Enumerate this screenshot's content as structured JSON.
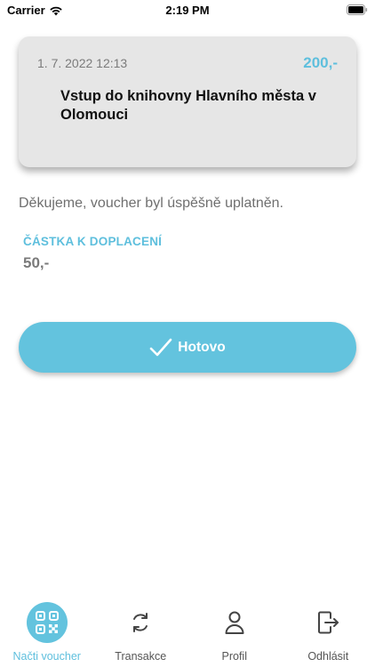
{
  "status_bar": {
    "carrier": "Carrier",
    "time": "2:19 PM"
  },
  "voucher": {
    "date": "1. 7. 2022 12:13",
    "amount": "200,-",
    "title": "Vstup do knihovny Hlavního města v Olomouci"
  },
  "message": "Děkujeme, voucher byl úspěšně uplatněn.",
  "payment": {
    "label": "ČÁSTKA K DOPLACENÍ",
    "value": "50,-"
  },
  "done_button": {
    "label": "Hotovo"
  },
  "tabs": [
    {
      "label": "Načti voucher",
      "icon": "qr-code-icon",
      "active": true
    },
    {
      "label": "Transakce",
      "icon": "refresh-icon",
      "active": false
    },
    {
      "label": "Profil",
      "icon": "person-icon",
      "active": false
    },
    {
      "label": "Odhlásit",
      "icon": "logout-icon",
      "active": false
    }
  ],
  "colors": {
    "accent": "#63c3de",
    "card_bg": "#e6e6e6",
    "text_muted": "#6f6f6f"
  }
}
